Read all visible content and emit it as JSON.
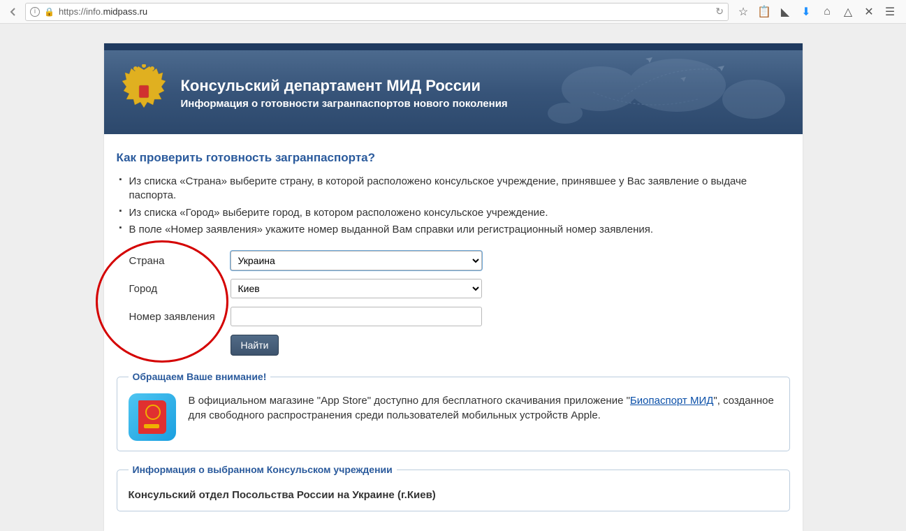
{
  "browser": {
    "url_prefix": "https://",
    "url_host_pre": "info.",
    "url_host_main": "midpass.ru"
  },
  "header": {
    "title": "Консульский департамент МИД России",
    "subtitle": "Информация о готовности загранпаспортов нового поколения"
  },
  "section_title": "Как проверить готовность загранпаспорта?",
  "instructions": [
    "Из списка «Страна» выберите страну, в которой расположено консульское учреждение, принявшее у Вас заявление о выдаче паспорта.",
    "Из списка «Город» выберите город, в котором расположено консульское учреждение.",
    "В поле «Номер заявления» укажите номер выданной Вам справки или регистрационный номер заявления."
  ],
  "form": {
    "country_label": "Страна",
    "country_value": "Украина",
    "city_label": "Город",
    "city_value": "Киев",
    "app_number_label": "Номер заявления",
    "app_number_value": "",
    "submit_label": "Найти"
  },
  "notice": {
    "legend": "Обращаем Ваше внимание!",
    "text_before": "В официальном магазине \"App Store\" доступно для бесплатного скачивания приложение \"",
    "link_text": "Биопаспорт МИД",
    "text_after": "\", созданное для свободного распространения среди пользователей мобильных устройств Apple."
  },
  "consulate": {
    "legend": "Информация о выбранном Консульском учреждении",
    "title": "Консульский отдел Посольства России на Украине (г.Киев)"
  }
}
